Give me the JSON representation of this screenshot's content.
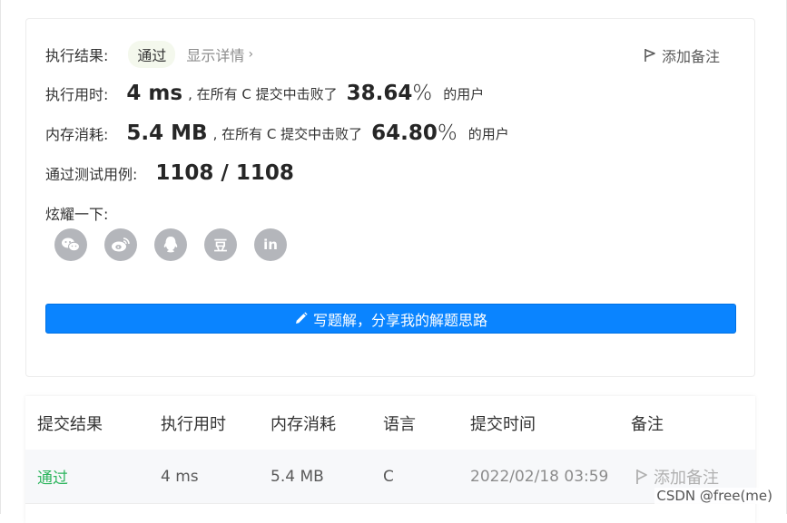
{
  "result": {
    "label": "执行结果:",
    "status": "通过",
    "detail_link": "显示详情",
    "add_note": "添加备注"
  },
  "runtime": {
    "label": "执行用时:",
    "value": "4 ms",
    "beat_text": ", 在所有 C 提交中击败了",
    "percent": "38.64",
    "suffix": "的用户"
  },
  "memory": {
    "label": "内存消耗:",
    "value": "5.4 MB",
    "beat_text": ", 在所有 C 提交中击败了",
    "percent": "64.80",
    "suffix": "的用户"
  },
  "tests": {
    "label": "通过测试用例:",
    "value": "1108 / 1108"
  },
  "share": {
    "label": "炫耀一下:",
    "icons": [
      "wechat-icon",
      "weibo-icon",
      "qq-icon",
      "douban-icon",
      "linkedin-icon"
    ],
    "douban_glyph": "豆",
    "linkedin_glyph": "in"
  },
  "write_button": "写题解，分享我的解题思路",
  "table": {
    "headers": [
      "提交结果",
      "执行用时",
      "内存消耗",
      "语言",
      "提交时间",
      "备注"
    ],
    "rows": [
      {
        "status": "通过",
        "runtime": "4 ms",
        "memory": "5.4 MB",
        "language": "C",
        "time": "2022/02/18 03:59",
        "note": "添加备注"
      }
    ]
  },
  "watermark": "CSDN @free(me)",
  "colors": {
    "accent_blue": "#0a84ff",
    "success_green": "#2db55d",
    "icon_grey": "#b4b6bb"
  }
}
